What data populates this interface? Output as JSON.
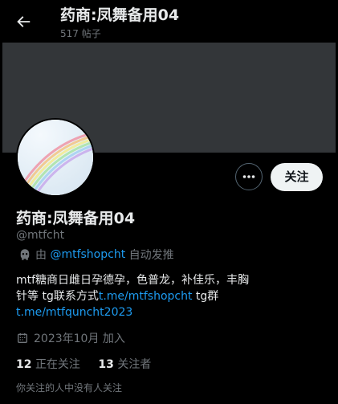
{
  "header": {
    "title": "药商:凤舞备用04",
    "post_count": "517 帖子"
  },
  "profile": {
    "display_name": "药商:凤舞备用04",
    "handle": "@mtfcht",
    "automated": {
      "prefix": "由",
      "link": "@mtfshopcht",
      "suffix": "自动发推"
    },
    "bio": {
      "text1": "mtf糖商日雌日孕德孕，色普龙，补佳乐，丰胸针等 tg联系方式",
      "link1": "t.me/mtfshopcht",
      "text2": " tg群",
      "link2": "t.me/mtfquncht2023"
    },
    "joined": "2023年10月 加入",
    "following_count": "12",
    "following_label": "正在关注",
    "followers_count": "13",
    "followers_label": "关注者",
    "mutual_note": "你关注的人中没有人关注"
  },
  "buttons": {
    "follow": "关注"
  },
  "colors": {
    "accent": "#1d9bf0",
    "background": "#000000",
    "banner": "#333639",
    "muted": "#71767b"
  }
}
